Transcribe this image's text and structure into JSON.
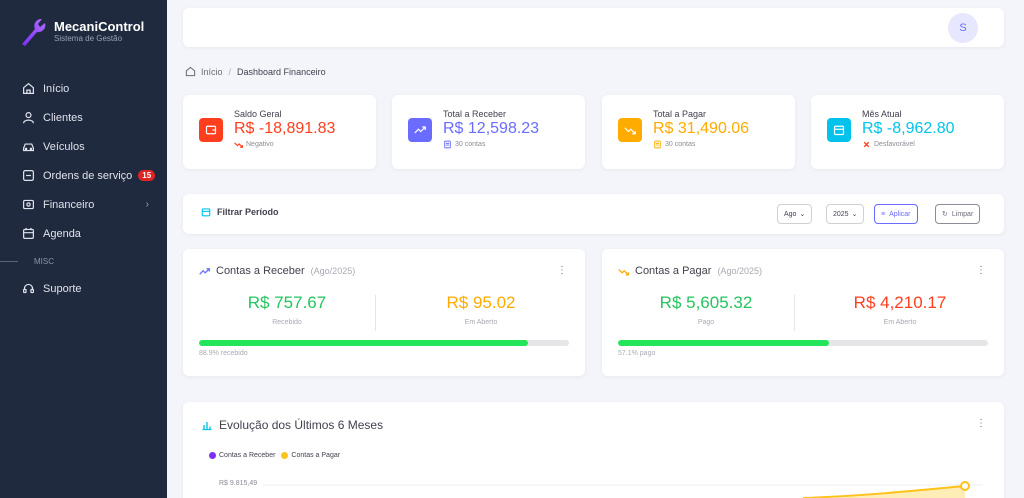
{
  "app": {
    "name": "MecaniControl",
    "subtitle": "Sistema de Gestão"
  },
  "sidebar": {
    "items": [
      {
        "label": "Início",
        "icon": "home-icon"
      },
      {
        "label": "Clientes",
        "icon": "user-icon"
      },
      {
        "label": "Veículos",
        "icon": "car-icon"
      },
      {
        "label": "Ordens de serviço",
        "icon": "clipboard-icon",
        "badge": "15"
      },
      {
        "label": "Financeiro",
        "icon": "wallet-icon",
        "chevron": "›"
      },
      {
        "label": "Agenda",
        "icon": "calendar-icon"
      }
    ],
    "section": "MISC",
    "support": {
      "label": "Suporte",
      "icon": "headset-icon"
    }
  },
  "topbar": {
    "avatar_initial": "S"
  },
  "breadcrumb": {
    "home": "Início",
    "separator": "/",
    "current": "Dashboard Financeiro"
  },
  "stats": [
    {
      "title": "Saldo Geral",
      "value": "R$ -18,891.83",
      "sub": "Negativo",
      "color": "#ff3e1d",
      "icon": "wallet-icon",
      "sub_icon": "trending-down-icon"
    },
    {
      "title": "Total a Receber",
      "value": "R$ 12,598.23",
      "sub": "30 contas",
      "color": "#696cff",
      "icon": "trending-up-icon",
      "sub_icon": "document-icon"
    },
    {
      "title": "Total a Pagar",
      "value": "R$ 31,490.06",
      "sub": "30 contas",
      "color": "#ffab00",
      "icon": "trending-down-icon",
      "sub_icon": "document-icon"
    },
    {
      "title": "Mês Atual",
      "value": "R$ -8,962.80",
      "sub": "Desfavorável",
      "color": "#03c3ec",
      "icon": "calendar-icon",
      "sub_icon": "x-icon"
    }
  ],
  "filter": {
    "title": "Filtrar Período",
    "month": "Ago",
    "year": "2025",
    "apply": "Aplicar",
    "clear": "Limpar"
  },
  "receber": {
    "title": "Contas a Receber",
    "period": "(Ago/2025)",
    "left_value": "R$ 757.67",
    "left_label": "Recebido",
    "right_value": "R$ 95.02",
    "right_label": "Em Aberto",
    "progress": 0.889,
    "note": "88.9% recebido"
  },
  "pagar": {
    "title": "Contas a Pagar",
    "period": "(Ago/2025)",
    "left_value": "R$ 5,605.32",
    "left_label": "Pago",
    "right_value": "R$ 4,210.17",
    "right_label": "Em Aberto",
    "progress": 0.571,
    "note": "57.1% pago"
  },
  "evolution": {
    "title": "Evolução dos Últimos 6 Meses",
    "legend": [
      {
        "name": "Contas a Receber",
        "color": "#7b2ff7"
      },
      {
        "name": "Contas a Pagar",
        "color": "#ffc21a"
      }
    ],
    "y_tick": "R$ 9.815,49"
  },
  "colors": {
    "green": "#22c55e",
    "amber": "#ffab00",
    "red": "#ff3e1d"
  }
}
